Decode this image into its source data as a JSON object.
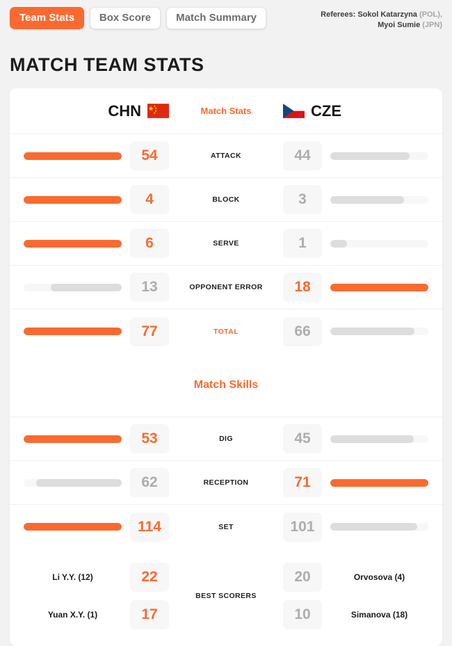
{
  "tabs": [
    {
      "label": "Team Stats",
      "active": true
    },
    {
      "label": "Box Score",
      "active": false
    },
    {
      "label": "Match Summary",
      "active": false
    }
  ],
  "referees": {
    "prefix": "Referees:",
    "line1_name": "Sokol Katarzyna",
    "line1_country": "(POL),",
    "line2_name": "Myoi Sumie",
    "line2_country": "(JPN)"
  },
  "page_title": "MATCH TEAM STATS",
  "teams": {
    "home": {
      "code": "CHN",
      "flag": "cn-flag-icon"
    },
    "away": {
      "code": "CZE",
      "flag": "cz-flag-icon"
    }
  },
  "sections": {
    "stats_header": "Match Stats",
    "skills_header": "Match Skills",
    "best_scorers_label": "BEST SCORERS"
  },
  "colors": {
    "accent": "#fa6a30",
    "loser_bar": "#dddddd",
    "track": "#f7f7f7",
    "page_bg": "#f2f2f2"
  },
  "chart_data": {
    "type": "bar",
    "title": "MATCH TEAM STATS",
    "categories": [
      "ATTACK",
      "BLOCK",
      "SERVE",
      "OPPONENT ERROR",
      "TOTAL",
      "DIG",
      "RECEPTION",
      "SET"
    ],
    "series": [
      {
        "name": "CHN",
        "values": [
          54,
          4,
          6,
          13,
          77,
          53,
          62,
          114
        ]
      },
      {
        "name": "CZE",
        "values": [
          44,
          3,
          1,
          18,
          66,
          45,
          71,
          101
        ]
      }
    ],
    "legend_position": "top",
    "grid": false
  },
  "stats_rows": [
    {
      "label": "ATTACK",
      "accent": false,
      "home": 54,
      "away": 44,
      "home_pct": 100,
      "away_pct": 81,
      "winner": "home"
    },
    {
      "label": "BLOCK",
      "accent": false,
      "home": 4,
      "away": 3,
      "home_pct": 100,
      "away_pct": 75,
      "winner": "home"
    },
    {
      "label": "SERVE",
      "accent": false,
      "home": 6,
      "away": 1,
      "home_pct": 100,
      "away_pct": 17,
      "winner": "home"
    },
    {
      "label": "OPPONENT ERROR",
      "accent": false,
      "home": 13,
      "away": 18,
      "home_pct": 72,
      "away_pct": 100,
      "winner": "away"
    },
    {
      "label": "TOTAL",
      "accent": true,
      "home": 77,
      "away": 66,
      "home_pct": 100,
      "away_pct": 86,
      "winner": "home"
    }
  ],
  "skills_rows": [
    {
      "label": "DIG",
      "accent": false,
      "home": 53,
      "away": 45,
      "home_pct": 100,
      "away_pct": 85,
      "winner": "home"
    },
    {
      "label": "RECEPTION",
      "accent": false,
      "home": 62,
      "away": 71,
      "home_pct": 87,
      "away_pct": 100,
      "winner": "away"
    },
    {
      "label": "SET",
      "accent": false,
      "home": 114,
      "away": 101,
      "home_pct": 100,
      "away_pct": 89,
      "winner": "home"
    }
  ],
  "best_scorers": [
    {
      "home_name": "Li Y.Y. (12)",
      "home_value": 22,
      "away_value": 20,
      "away_name": "Orvosova (4)"
    },
    {
      "home_name": "Yuan X.Y. (1)",
      "home_value": 17,
      "away_value": 10,
      "away_name": "Simanova (18)"
    }
  ]
}
